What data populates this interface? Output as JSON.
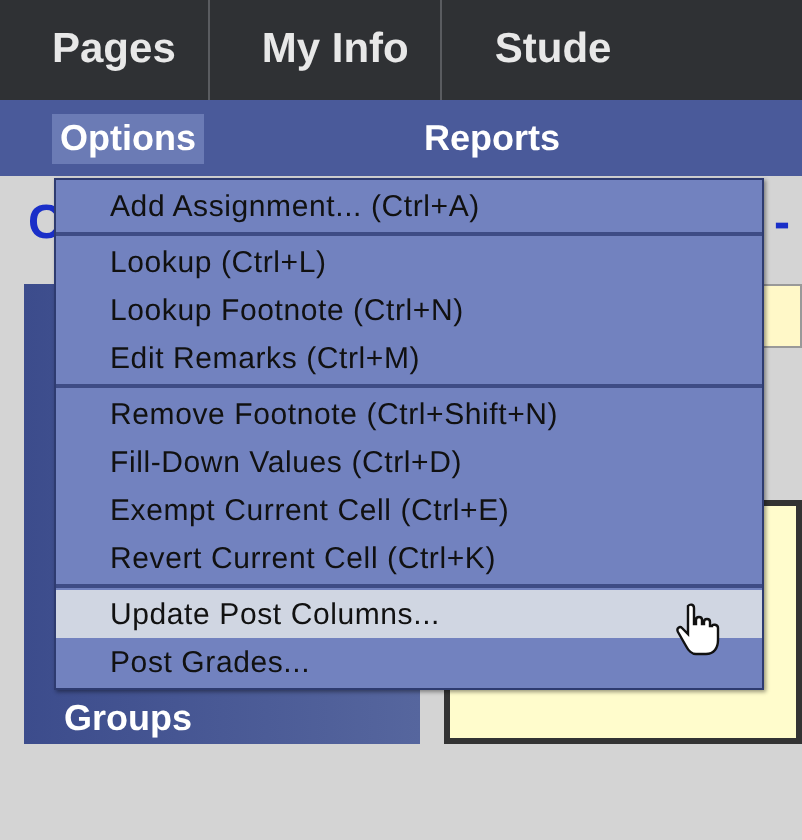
{
  "top_nav": [
    {
      "label": "Pages"
    },
    {
      "label": "My Info"
    },
    {
      "label": "Stude"
    }
  ],
  "sub_nav": [
    {
      "label": "Options",
      "selected": true
    },
    {
      "label": "Reports",
      "selected": false
    }
  ],
  "heading_fragments": [
    "C",
    "-"
  ],
  "sidebar": {
    "label": "Groups"
  },
  "menu": {
    "groups": [
      [
        {
          "label": "Add Assignment... (Ctrl+A)",
          "selected": false
        }
      ],
      [
        {
          "label": "Lookup (Ctrl+L)",
          "selected": false
        },
        {
          "label": "Lookup Footnote (Ctrl+N)",
          "selected": false
        },
        {
          "label": "Edit Remarks (Ctrl+M)",
          "selected": false
        }
      ],
      [
        {
          "label": "Remove Footnote (Ctrl+Shift+N)",
          "selected": false
        },
        {
          "label": "Fill-Down Values (Ctrl+D)",
          "selected": false
        },
        {
          "label": "Exempt Current Cell (Ctrl+E)",
          "selected": false
        },
        {
          "label": "Revert Current Cell (Ctrl+K)",
          "selected": false
        }
      ],
      [
        {
          "label": "Update Post Columns...",
          "selected": true
        },
        {
          "label": "Post Grades...",
          "selected": false
        }
      ]
    ]
  }
}
